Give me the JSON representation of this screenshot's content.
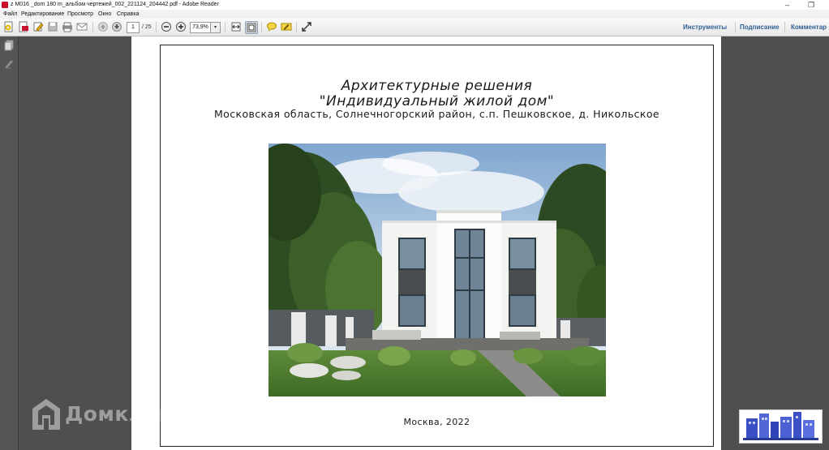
{
  "window": {
    "title": "z M016 _dom 180 m_альбом чертежей_002_221124_204442.pdf - Adobe Reader",
    "minimize_glyph": "‒",
    "restore_glyph": "❐"
  },
  "menu": [
    "Файл",
    "Редактирование",
    "Просмотр",
    "Окно",
    "Справка"
  ],
  "toolbar": {
    "icons": [
      "create-pdf-icon",
      "pdf-convert-icon",
      "edit-icon",
      "save-icon",
      "print-icon",
      "email-icon",
      "prev-page-icon",
      "next-page-icon",
      "zoom-out-icon",
      "zoom-in-icon",
      "fit-width-icon",
      "full-screen-icon",
      "comment-icon",
      "highlight-icon",
      "read-mode-icon"
    ],
    "page_current": "1",
    "page_total": "/ 25",
    "zoom": "73,9%",
    "zoom_dropdown_glyph": "▾"
  },
  "right_panels": {
    "tools": "Инструменты",
    "sign": "Подписание",
    "comment": "Комментар"
  },
  "document": {
    "title_line1": "Архитектурные решения",
    "title_line2": "\"Индивидуальный жилой дом\"",
    "address": "Московская область, Солнечногорский район, с.п. Пешковское, д. Никольское",
    "footer": "Москва, 2022"
  },
  "watermark": {
    "brand": "Домклик"
  },
  "colors": {
    "app_bg": "#4a4a4a",
    "panel_link": "#2e5f95",
    "adobe_red": "#c8102e"
  }
}
